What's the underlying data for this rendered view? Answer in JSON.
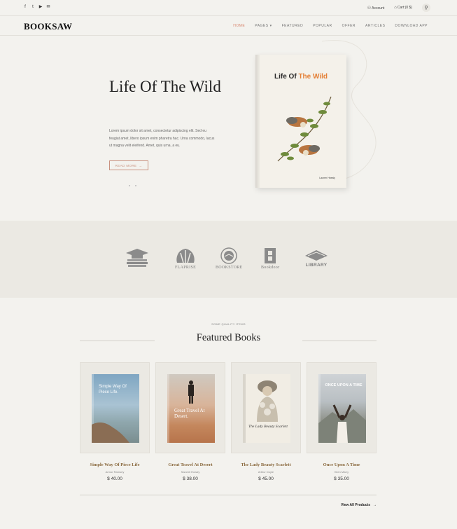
{
  "topbar": {
    "social": [
      {
        "icon": "facebook-icon",
        "glyph": "f"
      },
      {
        "icon": "twitter-icon",
        "glyph": "t"
      },
      {
        "icon": "youtube-icon",
        "glyph": "▶"
      },
      {
        "icon": "mail-icon",
        "glyph": "✉"
      }
    ],
    "account_label": "Account",
    "cart_label": "Cart:(0 $)"
  },
  "nav": {
    "logo": "BOOKSAW",
    "items": [
      "HOME",
      "PAGES",
      "FEATURED",
      "POPULAR",
      "OFFER",
      "ARTICLES",
      "DOWNLOAD APP"
    ],
    "active": "HOME"
  },
  "hero": {
    "title": "Life Of The Wild",
    "description": "Lorem ipsum dolor sit amet, consectetur adipiscing elit. Sed eu feugiat amet, libero ipsum enim pharetra hac. Urna commodo, lacus ut magna velit eleifend. Amet, quis urna, a eu.",
    "button_label": "READ MORE",
    "book": {
      "title_part1": "Life Of ",
      "title_part2": "The Wild",
      "author": "Lauren Hnealy"
    }
  },
  "brands": [
    "",
    "FLAPRISE",
    "BOOKSTORE",
    "Bookdoor",
    "LIBRARY"
  ],
  "featured": {
    "eyebrow": "SOME QUALITY ITEMS",
    "title": "Featured Books",
    "books": [
      {
        "title": "Simple Way Of Piece Life",
        "author": "Armor Ramsey",
        "price": "$ 40.00",
        "cover_text": "Simple Way Of Piece Life."
      },
      {
        "title": "Great Travel At Desert",
        "author": "Sanchit Howdy",
        "price": "$ 38.00",
        "cover_text": "Great Travel At Desert."
      },
      {
        "title": "The Lady Beauty Scarlett",
        "author": "Arthur Doyle",
        "price": "$ 45.00",
        "cover_text": "The Lady Beauty Scarlett"
      },
      {
        "title": "Once Upon A Time",
        "author": "Klien Marry",
        "price": "$ 35.00",
        "cover_text": "ONCE UPON A TIME"
      }
    ],
    "view_all": "View All Products"
  },
  "colors": {
    "accent": "#d7846d",
    "background": "#f3f2ee",
    "band": "#ebe9e3",
    "book_title": "#8a6a3f"
  }
}
